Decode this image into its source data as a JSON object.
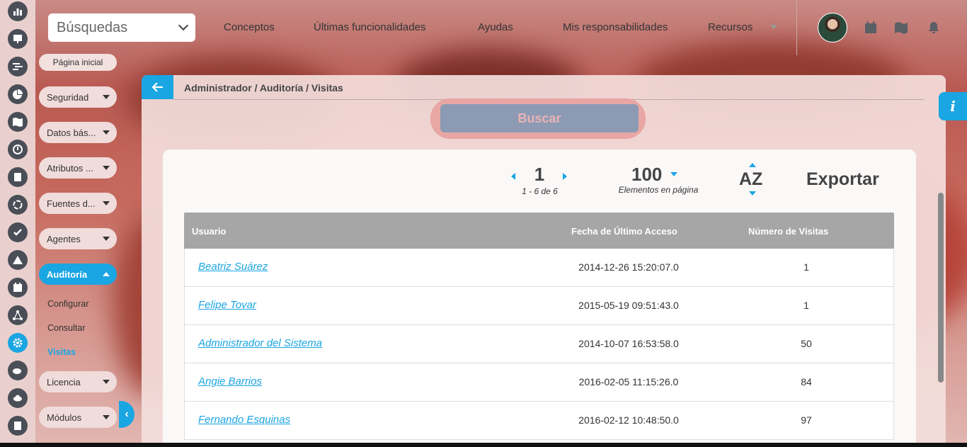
{
  "topbar": {
    "search_select": "Búsquedas",
    "nav": [
      "Conceptos",
      "Últimas funcionalidades",
      "Ayudas",
      "Mis responsabilidades",
      "Recursos"
    ]
  },
  "sidebar": {
    "home": "Página inicial",
    "items": [
      {
        "label": "Seguridad"
      },
      {
        "label": "Datos bás..."
      },
      {
        "label": "Atributos ..."
      },
      {
        "label": "Fuentes d..."
      },
      {
        "label": "Agentes"
      },
      {
        "label": "Auditoría"
      },
      {
        "label": "Licencia"
      },
      {
        "label": "Módulos"
      }
    ],
    "submenu": [
      "Configurar",
      "Consultar",
      "Visitas"
    ]
  },
  "main": {
    "breadcrumb": "Administrador / Auditoría / Visitas",
    "search_button": "Buscar",
    "info_label": "i"
  },
  "results": {
    "page": "1",
    "range": "1 - 6 de 6",
    "per_page": "100",
    "per_page_label": "Elementos en página",
    "sort_label": "AZ",
    "export_label": "Exportar",
    "columns": [
      "Usuario",
      "Fecha de Último Acceso",
      "Número de Visitas"
    ],
    "rows": [
      {
        "user": "Beatriz Suárez",
        "date": "2014-12-26 15:20:07.0",
        "visits": "1"
      },
      {
        "user": "Felipe Tovar",
        "date": "2015-05-19 09:51:43.0",
        "visits": "1"
      },
      {
        "user": "Administrador del Sistema",
        "date": "2014-10-07 16:53:58.0",
        "visits": "50"
      },
      {
        "user": "Angie Barrios",
        "date": "2016-02-05 11:15:26.0",
        "visits": "84"
      },
      {
        "user": "Fernando Esquinas",
        "date": "2016-02-12 10:48:50.0",
        "visits": "97"
      }
    ]
  },
  "colors": {
    "accent": "#1aa5e3",
    "header_gray": "#a6a6a6",
    "button_gray": "#8d9ab3"
  }
}
